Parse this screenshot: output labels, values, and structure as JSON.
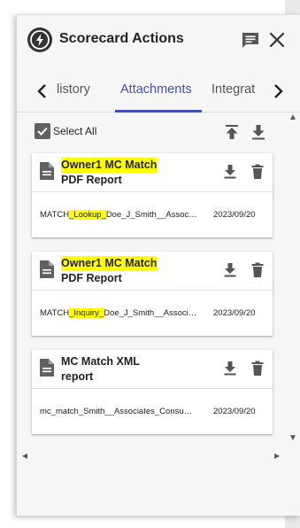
{
  "panel": {
    "title": "Scorecard Actions",
    "logo_icon": "lightning-bolt-icon",
    "chat_icon": "chat-icon",
    "close_icon": "close-icon"
  },
  "tabs": {
    "items": [
      {
        "label": "History",
        "visible_text": "listory",
        "active": false
      },
      {
        "label": "Attachments",
        "active": true
      },
      {
        "label": "Integrat",
        "active": false
      }
    ],
    "accent_color": "#3f51b5"
  },
  "toolbar": {
    "select_all_label": "Select All",
    "select_all_checked": true,
    "upload_icon": "upload-icon",
    "download_all_icon": "download-icon"
  },
  "attachments": [
    {
      "title_line1": "Owner1 MC Match",
      "title_line2": "PDF Report",
      "title_highlighted": true,
      "file_prefix": "MATCH",
      "file_highlight": "_Lookup_",
      "file_suffix": "Doe_J_Smith__Associates_Consumer",
      "date": "2023/09/20"
    },
    {
      "title_line1": "Owner1 MC Match",
      "title_line2": "PDF Report",
      "title_highlighted": true,
      "file_prefix": "MATCH",
      "file_highlight": "_Inquiry_",
      "file_suffix": "Doe_J_Smith__Associates_Consumer",
      "date": "2023/09/20"
    },
    {
      "title_line1": "MC Match XML",
      "title_line2": "report",
      "title_highlighted": false,
      "file_prefix": "mc_match_Smith__Associates_Consumer",
      "file_highlight": "",
      "file_suffix": "",
      "date": "2023/09/20"
    }
  ],
  "colors": {
    "highlight": "#ffff00",
    "icon_gray": "#616161"
  }
}
